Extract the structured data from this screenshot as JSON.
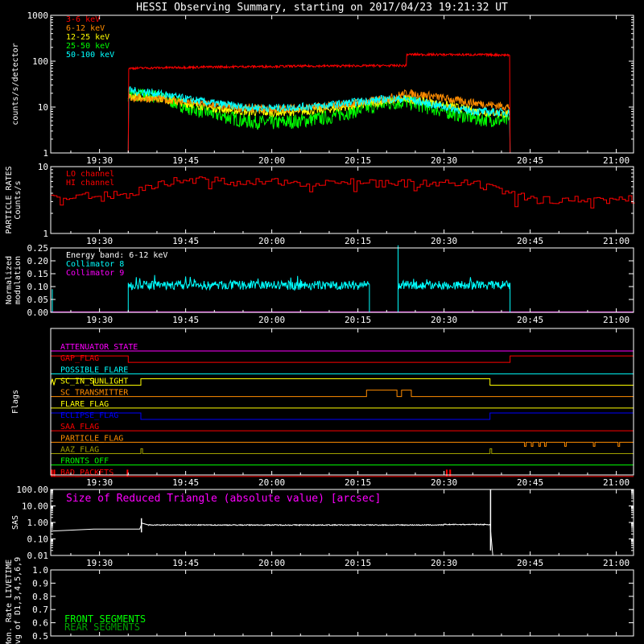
{
  "title": "HESSI Observing Summary, starting on 2017/04/23 19:21:32 UT",
  "colors": {
    "bg": "#000000",
    "fg": "#ffffff",
    "red": "#ff0000",
    "orange": "#ff8c00",
    "yellow": "#ffff00",
    "green": "#00ff00",
    "cyan": "#00ffff",
    "magenta": "#ff00ff",
    "blue": "#0000ff",
    "olive": "#a0a000",
    "darkgreen": "#00a000"
  },
  "time_axis": {
    "start_min": 1161.5,
    "end_min": 1263,
    "ticks": [
      {
        "min": 1170,
        "label": "19:30"
      },
      {
        "min": 1185,
        "label": "19:45"
      },
      {
        "min": 1200,
        "label": "20:00"
      },
      {
        "min": 1215,
        "label": "20:15"
      },
      {
        "min": 1230,
        "label": "20:30"
      },
      {
        "min": 1245,
        "label": "20:45"
      },
      {
        "min": 1260,
        "label": "21:00"
      }
    ]
  },
  "chart_data": [
    {
      "type": "line",
      "panel": "count-rates",
      "ylabel": "counts/s/detector",
      "yscale": "log",
      "ylim": [
        1,
        1000
      ],
      "yticks": [
        "1",
        "10",
        "100",
        "1000"
      ],
      "legend": [
        "3-6 keV",
        "6-12 keV",
        "12-25 keV",
        "25-50 keV",
        "50-100 keV"
      ],
      "legend_colors": [
        "#ff0000",
        "#ff8c00",
        "#ffff00",
        "#00ff00",
        "#00ffff"
      ],
      "series": [
        {
          "name": "3-6 keV",
          "color": "#ff0000",
          "x": [
            1161.5,
            1175.0,
            1175.0,
            1190,
            1205,
            1220,
            1223.5,
            1223.5,
            1238,
            1241.5,
            1241.5,
            1263
          ],
          "y": [
            1,
            1,
            70,
            75,
            78,
            80,
            80,
            140,
            138,
            136,
            1,
            1
          ]
        },
        {
          "name": "6-12 keV",
          "color": "#ff8c00",
          "x": [
            1175.0,
            1180,
            1185,
            1190,
            1195,
            1200,
            1205,
            1210,
            1215,
            1220,
            1223.5,
            1227,
            1232,
            1236,
            1241.5
          ],
          "y": [
            16,
            15,
            13,
            11,
            9.5,
            9,
            9.5,
            10.5,
            12.5,
            15,
            20,
            18,
            14,
            12,
            10
          ]
        },
        {
          "name": "12-25 keV",
          "color": "#ffff00",
          "x": [
            1175.0,
            1180,
            1185,
            1190,
            1195,
            1200,
            1205,
            1210,
            1215,
            1220,
            1223.5,
            1227,
            1232,
            1236,
            1241.5
          ],
          "y": [
            17,
            16,
            12,
            9.5,
            8,
            7.5,
            8,
            9,
            11,
            13.5,
            15,
            13,
            10,
            8,
            7
          ]
        },
        {
          "name": "25-50 keV",
          "color": "#00ff00",
          "x": [
            1175.0,
            1180,
            1185,
            1190,
            1195,
            1200,
            1205,
            1210,
            1215,
            1220,
            1223.5,
            1227,
            1232,
            1236,
            1241.5
          ],
          "y": [
            19,
            17,
            10,
            7,
            5,
            4.5,
            5,
            6,
            8.5,
            12,
            13,
            10,
            7,
            5.5,
            5
          ]
        },
        {
          "name": "50-100 keV",
          "color": "#00ffff",
          "x": [
            1161.5,
            1175.0,
            1175.0,
            1180,
            1185,
            1190,
            1195,
            1200,
            1205,
            1210,
            1215,
            1220,
            1223.5,
            1227,
            1232,
            1236,
            1241.5,
            1241.5,
            1263
          ],
          "y": [
            1,
            1,
            23,
            20,
            15,
            12,
            10,
            9.5,
            10,
            11,
            13,
            15,
            15,
            12,
            9,
            8,
            7.5,
            1,
            1
          ]
        }
      ]
    },
    {
      "type": "line",
      "panel": "particle-rates",
      "ylabel": "PARTICLE RATES Counts/s",
      "yscale": "log",
      "ylim": [
        1,
        10
      ],
      "yticks": [
        "1",
        "10"
      ],
      "legend": [
        "LO channel",
        "HI channel"
      ],
      "legend_colors": [
        "#ff0000",
        "#ff0000"
      ],
      "series": [
        {
          "name": "LO channel",
          "color": "#ff0000",
          "x": [
            1161.5,
            1175,
            1180,
            1185,
            1195,
            1205,
            1215,
            1225,
            1235,
            1240,
            1245,
            1250,
            1263
          ],
          "y": [
            3.5,
            3.8,
            5.5,
            6.5,
            5.8,
            5.8,
            6,
            5.5,
            5.5,
            4.2,
            3.2,
            3.2,
            3.2
          ]
        },
        {
          "name": "HI channel",
          "color": "#ff0000",
          "x": [
            1161.5,
            1263
          ],
          "y": [
            1,
            1
          ]
        }
      ]
    },
    {
      "type": "line",
      "panel": "modulation",
      "ylabel": "Normalized modulation",
      "ylim": [
        0,
        0.25
      ],
      "yticks": [
        "0.00",
        "0.05",
        "0.10",
        "0.15",
        "0.20",
        "0.25"
      ],
      "legend": [
        "Energy band: 6-12 keV",
        "Collimator 8",
        "Collimator 9"
      ],
      "legend_colors": [
        "#ffffff",
        "#00ffff",
        "#ff00ff"
      ],
      "series": [
        {
          "name": "Collimator 8",
          "color": "#00ffff",
          "x": [
            1161.5,
            1175.0,
            1175.0,
            1217.0,
            1217.0,
            1222.0,
            1222.0,
            1222.0,
            1224.0,
            1241.5,
            1241.5,
            1263
          ],
          "y": [
            0,
            0,
            0.105,
            0.105,
            0,
            0,
            0.26,
            0.105,
            0.105,
            0.105,
            0,
            0
          ]
        },
        {
          "name": "Collimator 9",
          "color": "#ff00ff",
          "x": [
            1161.5,
            1263
          ],
          "y": [
            0,
            0
          ]
        }
      ]
    },
    {
      "type": "line",
      "panel": "flags",
      "ylabel": "Flags",
      "series": [
        {
          "name": "ATTENUATOR_STATE",
          "color": "#ff00ff"
        },
        {
          "name": "GAP_FLAG",
          "color": "#ff0000"
        },
        {
          "name": "POSSIBLE_FLARE",
          "color": "#00ffff"
        },
        {
          "name": "SC_IN_SUNLIGHT",
          "color": "#ffff00"
        },
        {
          "name": "SC_TRANSMITTER",
          "color": "#ff8c00"
        },
        {
          "name": "FLARE_FLAG",
          "color": "#ffff00"
        },
        {
          "name": "ECLIPSE_FLAG",
          "color": "#0000ff"
        },
        {
          "name": "SAA_FLAG",
          "color": "#ff0000"
        },
        {
          "name": "PARTICLE_FLAG",
          "color": "#ff8c00"
        },
        {
          "name": "AAZ_FLAG",
          "color": "#a0a000"
        },
        {
          "name": "FRONTS_OFF",
          "color": "#00ff00"
        },
        {
          "name": "BAD_PACKETS",
          "color": "#ff0000"
        }
      ]
    },
    {
      "type": "line",
      "panel": "sas",
      "ylabel": "SAS",
      "yscale": "log",
      "ylim": [
        0.01,
        100
      ],
      "yticks": [
        "0.01",
        "0.10",
        "1.00",
        "10.00",
        "100.00"
      ],
      "legend": [
        "Size of Reduced Triangle (absolute value) [arcsec]"
      ],
      "legend_colors": [
        "#ff00ff"
      ],
      "series": [
        {
          "name": "Size of Reduced Triangle",
          "color": "#ffffff",
          "x": [
            1161.5,
            1169.0,
            1169.0,
            1177.0,
            1177.4,
            1178.5,
            1185,
            1200,
            1215,
            1230,
            1238.0,
            1238.5,
            1263
          ],
          "y": [
            0.3,
            0.3,
            0.4,
            0.4,
            0.9,
            0.7,
            0.7,
            0.7,
            0.7,
            0.75,
            0.8,
            0.01,
            0.01
          ]
        }
      ]
    },
    {
      "type": "line",
      "panel": "livetime",
      "ylabel": "Mon. Rate LIVETIME avg of D1,3,4,5,6,9",
      "ylim": [
        0.5,
        1.0
      ],
      "yticks": [
        "0.5",
        "0.6",
        "0.7",
        "0.8",
        "0.9",
        "1.0"
      ],
      "legend": [
        "FRONT SEGMENTS",
        "REAR SEGMENTS"
      ],
      "legend_colors": [
        "#00ff00",
        "#00a000"
      ],
      "series": []
    }
  ]
}
